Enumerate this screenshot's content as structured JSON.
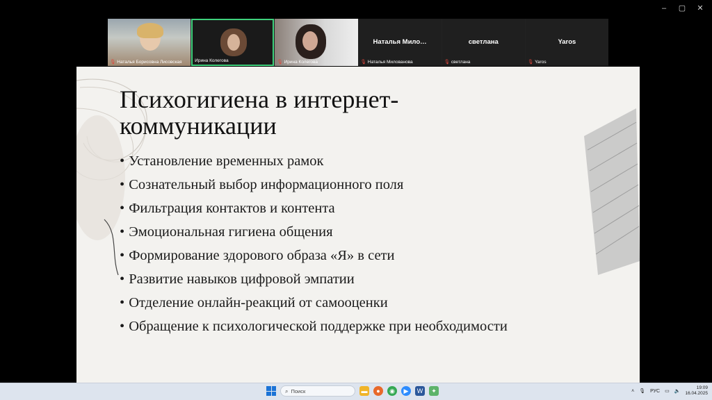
{
  "window": {
    "controls": [
      "–",
      "▢",
      "✕"
    ]
  },
  "participants": [
    {
      "name": "Наталья Борисовна Лисовская",
      "video": true,
      "muted": true
    },
    {
      "name": "Ирина Колегова",
      "video": true,
      "muted": false,
      "active": true
    },
    {
      "name": "Ирина Колегова",
      "video": true,
      "muted": true
    },
    {
      "display": "Наталья Мило…",
      "name": "Наталья Милованова",
      "video": false,
      "muted": true
    },
    {
      "display": "светлана",
      "name": "светлана",
      "video": false,
      "muted": true
    },
    {
      "display": "Yaros",
      "name": "Yaros",
      "video": false,
      "muted": true
    }
  ],
  "slide": {
    "title": "Психогигиена в интернет-коммуникации",
    "bullets": [
      "Установление временных рамок",
      "Сознательный выбор информационного поля",
      "Фильтрация контактов и контента",
      "Эмоциональная гигиена общения",
      "Формирование здорового образа «Я» в сети",
      "Развитие навыков цифровой эмпатии",
      "Отделение онлайн-реакций от самооценки",
      "Обращение к психологической поддержке при необходимости"
    ]
  },
  "taskbar": {
    "search_placeholder": "Поиск",
    "language": "РУС",
    "time": "19:09",
    "date": "16.04.2025",
    "apps": [
      "file-explorer",
      "firefox",
      "chrome",
      "zoom",
      "word",
      "other-app"
    ]
  },
  "colors": {
    "active_border": "#3fd17c",
    "muted_mic": "#e0463c",
    "slide_bg": "#f3f2ef"
  }
}
